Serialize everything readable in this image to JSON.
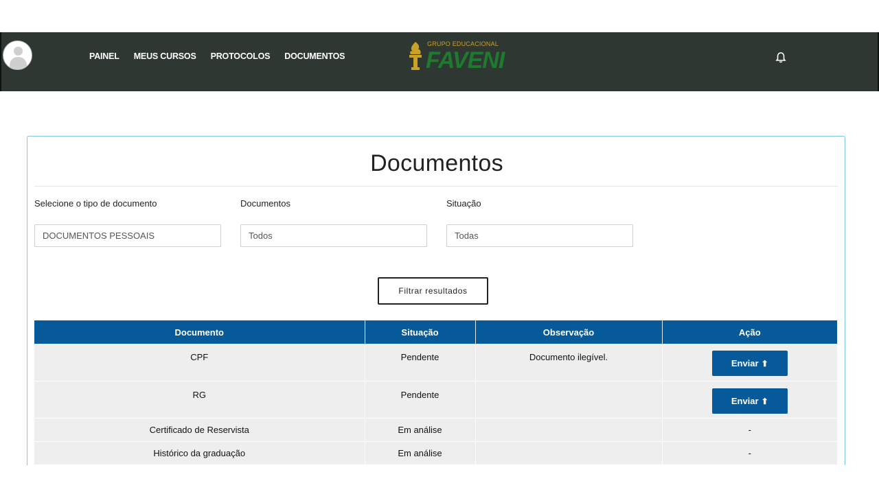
{
  "nav": {
    "items": [
      "PAINEL",
      "MEUS CURSOS",
      "PROTOCOLOS",
      "DOCUMENTOS"
    ]
  },
  "logo": {
    "small": "GRUPO EDUCACIONAL",
    "big": "FAVENI"
  },
  "page": {
    "title": "Documentos"
  },
  "filters": {
    "tipo_label": "Selecione o tipo de documento",
    "tipo_value": "DOCUMENTOS PESSOAIS",
    "docs_label": "Documentos",
    "docs_value": "Todos",
    "situacao_label": "Situação",
    "situacao_value": "Todas",
    "button": "Filtrar resultados"
  },
  "table": {
    "headers": [
      "Documento",
      "Situação",
      "Observação",
      "Ação"
    ],
    "rows": [
      {
        "documento": "CPF",
        "situacao": "Pendente",
        "observacao": "Documento ilegível.",
        "acao": "Enviar"
      },
      {
        "documento": "RG",
        "situacao": "Pendente",
        "observacao": "",
        "acao": "Enviar"
      },
      {
        "documento": "Certificado de Reservista",
        "situacao": "Em análise",
        "observacao": "",
        "acao": "-"
      },
      {
        "documento": "Histórico da graduação",
        "situacao": "Em análise",
        "observacao": "",
        "acao": "-"
      }
    ]
  },
  "colors": {
    "header_bar": "#2f3733",
    "table_header": "#065a9a",
    "accent_border": "#7fc4de"
  },
  "icons": [
    "avatar-icon",
    "bell-icon",
    "upload-icon"
  ]
}
